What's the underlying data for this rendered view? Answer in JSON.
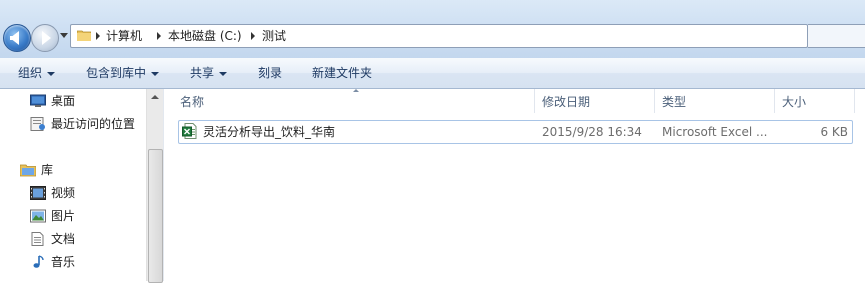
{
  "address_bar": {
    "crumbs": [
      "计算机",
      "本地磁盘 (C:)",
      "测试"
    ]
  },
  "toolbar": {
    "organize": "组织",
    "include_in_library": "包含到库中",
    "share": "共享",
    "burn": "刻录",
    "new_folder": "新建文件夹"
  },
  "nav_pane": {
    "items": [
      {
        "label": "桌面",
        "icon": "desktop-icon"
      },
      {
        "label": "最近访问的位置",
        "icon": "recent-places-icon"
      },
      {
        "label": "库",
        "icon": "libraries-icon"
      },
      {
        "label": "视频",
        "icon": "videos-icon"
      },
      {
        "label": "图片",
        "icon": "pictures-icon"
      },
      {
        "label": "文档",
        "icon": "documents-icon"
      },
      {
        "label": "音乐",
        "icon": "music-icon"
      }
    ]
  },
  "file_list": {
    "columns": {
      "name": "名称",
      "modified": "修改日期",
      "type": "类型",
      "size": "大小"
    },
    "rows": [
      {
        "name": "灵活分析导出_饮料_华南",
        "modified": "2015/9/28 16:34",
        "type": "Microsoft Excel ...",
        "size": "6 KB",
        "icon": "excel-file-icon"
      }
    ]
  }
}
